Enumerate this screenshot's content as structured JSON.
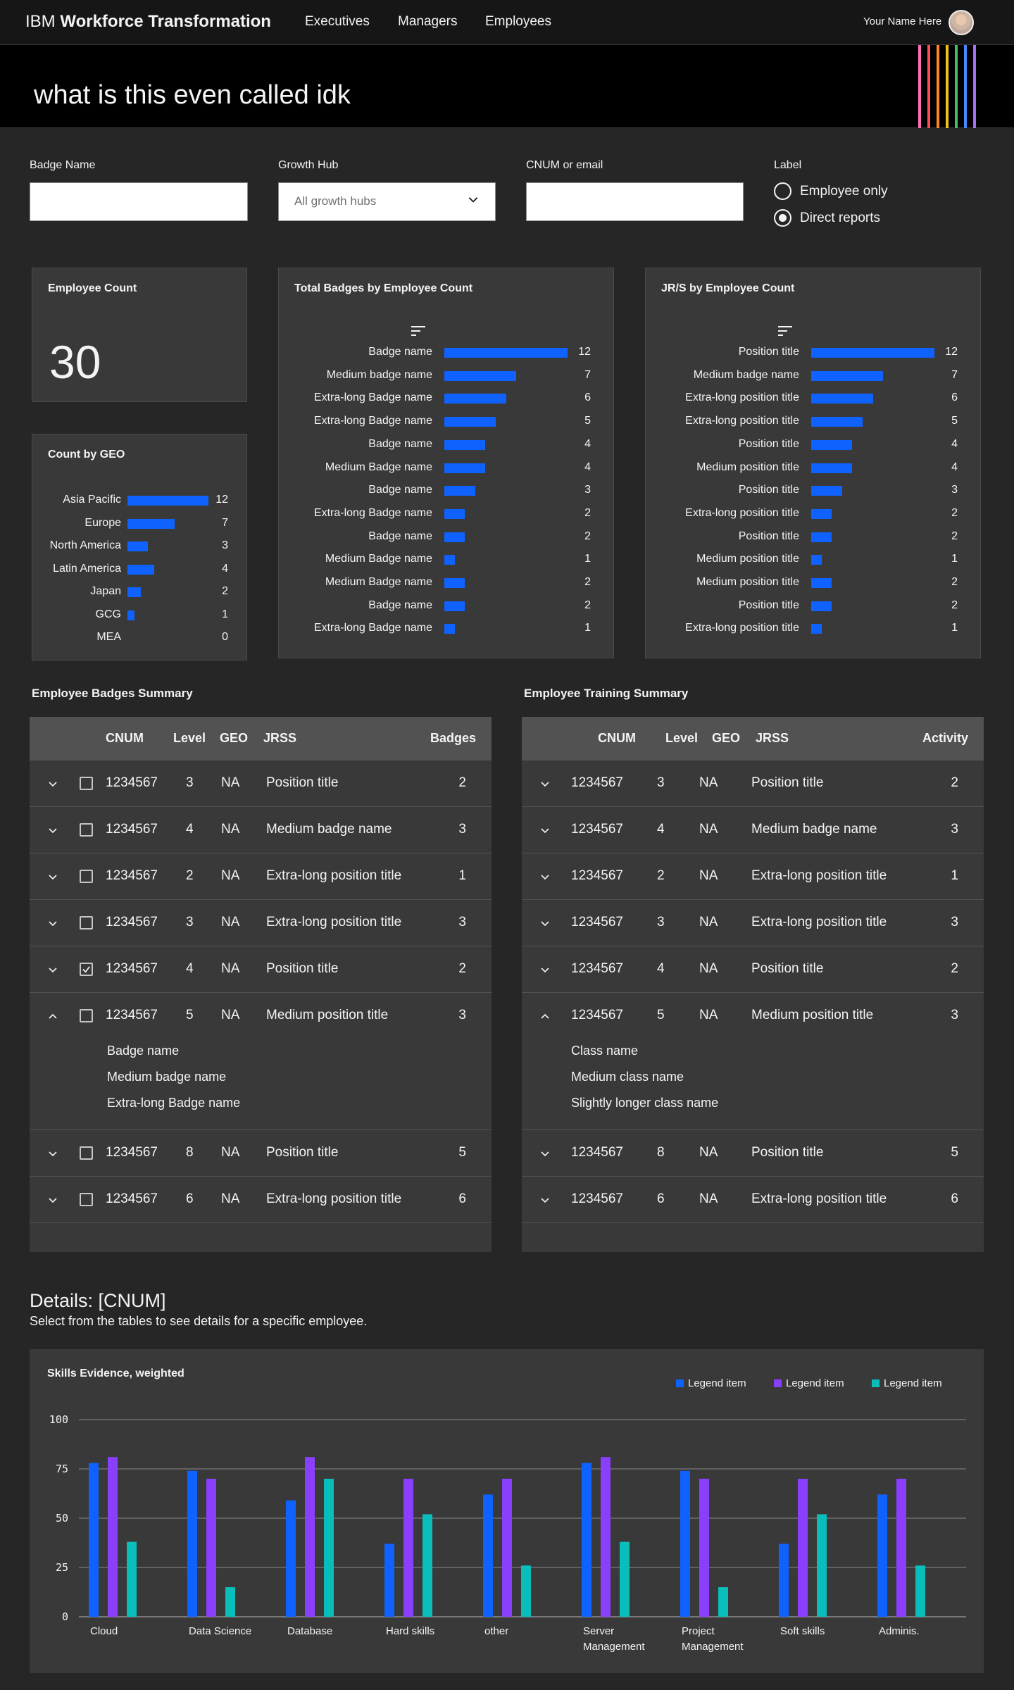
{
  "header": {
    "brand_prefix": "IBM",
    "brand_name": "Workforce Transformation",
    "nav": [
      "Executives",
      "Managers",
      "Employees"
    ],
    "user_name": "Your Name Here"
  },
  "banner": {
    "title": "what is this even called idk",
    "stripe_colors": [
      "#ff6eb4",
      "#fa4d56",
      "#ff832b",
      "#f1c21b",
      "#42be65",
      "#4589ff",
      "#a56eff"
    ]
  },
  "filters": {
    "badge_name_label": "Badge Name",
    "badge_name_value": "",
    "growth_hub_label": "Growth Hub",
    "growth_hub_value": "All growth hubs",
    "cnum_label": "CNUM or email",
    "cnum_value": "",
    "label_label": "Label",
    "radio_options": [
      "Employee only",
      "Direct reports"
    ],
    "radio_selected": "Direct reports"
  },
  "employee_count": {
    "title": "Employee Count",
    "value": "30"
  },
  "count_by_geo": {
    "title": "Count by GEO",
    "rows": [
      {
        "label": "Asia Pacific",
        "value": 12
      },
      {
        "label": "Europe",
        "value": 7
      },
      {
        "label": "North America",
        "value": 3
      },
      {
        "label": "Latin America",
        "value": 4
      },
      {
        "label": "Japan",
        "value": 2
      },
      {
        "label": "GCG",
        "value": 1
      },
      {
        "label": "MEA",
        "value": 0
      }
    ]
  },
  "total_badges": {
    "title": "Total Badges by Employee Count",
    "rows": [
      {
        "label": "Badge name",
        "value": 12
      },
      {
        "label": "Medium badge name",
        "value": 7
      },
      {
        "label": "Extra-long Badge name",
        "value": 6
      },
      {
        "label": "Extra-long Badge name",
        "value": 5
      },
      {
        "label": "Badge name",
        "value": 4
      },
      {
        "label": "Medium Badge name",
        "value": 4
      },
      {
        "label": "Badge name",
        "value": 3
      },
      {
        "label": "Extra-long Badge name",
        "value": 2
      },
      {
        "label": "Badge name",
        "value": 2
      },
      {
        "label": "Medium Badge name",
        "value": 1
      },
      {
        "label": "Medium Badge name",
        "value": 2
      },
      {
        "label": "Badge name",
        "value": 2
      },
      {
        "label": "Extra-long Badge name",
        "value": 1
      }
    ]
  },
  "jrs_by_count": {
    "title": "JR/S by Employee Count",
    "rows": [
      {
        "label": "Position title",
        "value": 12
      },
      {
        "label": "Medium badge name",
        "value": 7
      },
      {
        "label": "Extra-long position title",
        "value": 6
      },
      {
        "label": "Extra-long position title",
        "value": 5
      },
      {
        "label": "Position title",
        "value": 4
      },
      {
        "label": "Medium position title",
        "value": 4
      },
      {
        "label": "Position title",
        "value": 3
      },
      {
        "label": "Extra-long position title",
        "value": 2
      },
      {
        "label": "Position title",
        "value": 2
      },
      {
        "label": "Medium position title",
        "value": 1
      },
      {
        "label": "Medium position title",
        "value": 2
      },
      {
        "label": "Position title",
        "value": 2
      },
      {
        "label": "Extra-long position title",
        "value": 1
      }
    ]
  },
  "badges_table": {
    "title": "Employee Badges Summary",
    "columns": [
      "CNUM",
      "Level",
      "GEO",
      "JRSS",
      "Badges"
    ],
    "rows": [
      {
        "cnum": "1234567",
        "level": "3",
        "geo": "NA",
        "jrss": "Position title",
        "value": "2",
        "checked": false,
        "expanded": false
      },
      {
        "cnum": "1234567",
        "level": "4",
        "geo": "NA",
        "jrss": "Medium badge name",
        "value": "3",
        "checked": false,
        "expanded": false
      },
      {
        "cnum": "1234567",
        "level": "2",
        "geo": "NA",
        "jrss": "Extra-long position title",
        "value": "1",
        "checked": false,
        "expanded": false
      },
      {
        "cnum": "1234567",
        "level": "3",
        "geo": "NA",
        "jrss": "Extra-long position title",
        "value": "3",
        "checked": false,
        "expanded": false
      },
      {
        "cnum": "1234567",
        "level": "4",
        "geo": "NA",
        "jrss": "Position title",
        "value": "2",
        "checked": true,
        "expanded": false
      },
      {
        "cnum": "1234567",
        "level": "5",
        "geo": "NA",
        "jrss": "Medium position title",
        "value": "3",
        "checked": false,
        "expanded": true,
        "sub": [
          "Badge name",
          "Medium badge name",
          "Extra-long Badge name"
        ]
      },
      {
        "cnum": "1234567",
        "level": "8",
        "geo": "NA",
        "jrss": "Position title",
        "value": "5",
        "checked": false,
        "expanded": false
      },
      {
        "cnum": "1234567",
        "level": "6",
        "geo": "NA",
        "jrss": "Extra-long position title",
        "value": "6",
        "checked": false,
        "expanded": false
      }
    ]
  },
  "training_table": {
    "title": "Employee Training Summary",
    "columns": [
      "CNUM",
      "Level",
      "GEO",
      "JRSS",
      "Activity"
    ],
    "rows": [
      {
        "cnum": "1234567",
        "level": "3",
        "geo": "NA",
        "jrss": "Position title",
        "value": "2",
        "expanded": false
      },
      {
        "cnum": "1234567",
        "level": "4",
        "geo": "NA",
        "jrss": "Medium badge name",
        "value": "3",
        "expanded": false
      },
      {
        "cnum": "1234567",
        "level": "2",
        "geo": "NA",
        "jrss": "Extra-long position title",
        "value": "1",
        "expanded": false
      },
      {
        "cnum": "1234567",
        "level": "3",
        "geo": "NA",
        "jrss": "Extra-long position title",
        "value": "3",
        "expanded": false
      },
      {
        "cnum": "1234567",
        "level": "4",
        "geo": "NA",
        "jrss": "Position title",
        "value": "2",
        "expanded": false
      },
      {
        "cnum": "1234567",
        "level": "5",
        "geo": "NA",
        "jrss": "Medium position title",
        "value": "3",
        "expanded": true,
        "sub": [
          "Class name",
          "Medium class name",
          "Slightly longer class name"
        ]
      },
      {
        "cnum": "1234567",
        "level": "8",
        "geo": "NA",
        "jrss": "Position title",
        "value": "5",
        "expanded": false
      },
      {
        "cnum": "1234567",
        "level": "6",
        "geo": "NA",
        "jrss": "Extra-long position title",
        "value": "6",
        "expanded": false
      }
    ]
  },
  "details": {
    "title": "Details: [CNUM]",
    "subtitle": "Select from the tables to see details for a specific employee."
  },
  "chart_data": {
    "type": "bar",
    "title": "Skills Evidence, weighted",
    "categories": [
      "Cloud",
      "Data Science",
      "Database",
      "Hard skills",
      "other",
      "Server Management",
      "Project Management",
      "Soft skills",
      "Adminis."
    ],
    "series": [
      {
        "name": "Legend item",
        "color": "#0f62fe",
        "values": [
          78,
          74,
          59,
          37,
          62,
          78,
          74,
          37,
          62
        ]
      },
      {
        "name": "Legend item",
        "color": "#8a3ffc",
        "values": [
          81,
          70,
          81,
          70,
          70,
          81,
          70,
          70,
          70
        ]
      },
      {
        "name": "Legend item",
        "color": "#08bdba",
        "values": [
          38,
          15,
          70,
          52,
          26,
          38,
          15,
          52,
          26
        ]
      }
    ],
    "ylim": [
      0,
      100
    ],
    "yticks": [
      0,
      25,
      50,
      75,
      100
    ],
    "grid": true,
    "legend": "top-right"
  }
}
